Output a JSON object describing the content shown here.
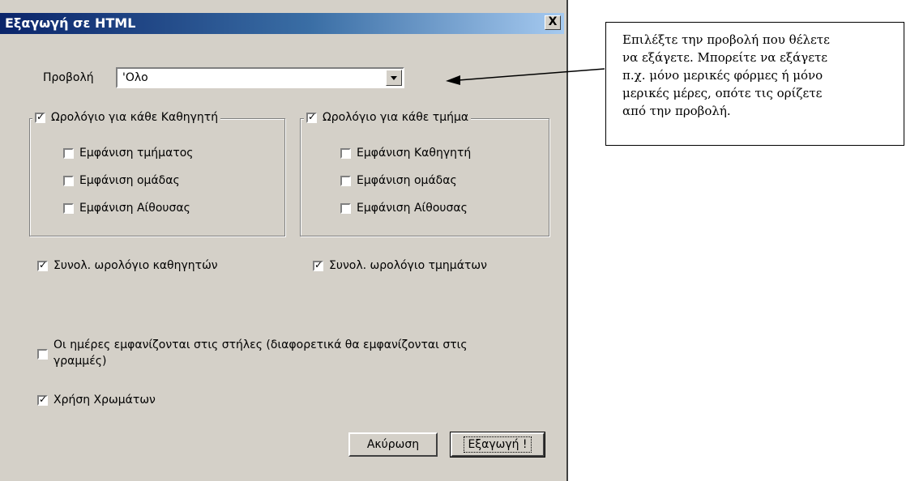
{
  "dialog": {
    "title": "Εξαγωγή σε HTML",
    "close_symbol": "X",
    "view_label": "Προβολή",
    "view_value": "'Ολο",
    "group_teacher": {
      "label": "Ωρολόγιο για κάθε Καθηγητή",
      "checked": true,
      "options": [
        {
          "label": "Εμφάνιση τμήματος",
          "checked": false
        },
        {
          "label": "Εμφάνιση ομάδας",
          "checked": false
        },
        {
          "label": "Εμφάνιση Αίθουσας",
          "checked": false
        }
      ]
    },
    "group_class": {
      "label": "Ωρολόγιο για κάθε τμήμα",
      "checked": true,
      "options": [
        {
          "label": "Εμφάνιση Καθηγητή",
          "checked": false
        },
        {
          "label": "Εμφάνιση ομάδας",
          "checked": false
        },
        {
          "label": "Εμφάνιση Αίθουσας",
          "checked": false
        }
      ]
    },
    "total_teachers": {
      "label": "Συνολ. ωρολόγιο καθηγητών",
      "checked": true
    },
    "total_classes": {
      "label": "Συνολ. ωρολόγιο τμημάτων",
      "checked": true
    },
    "days_in_columns": {
      "line1": "Οι ημέρες εμφανίζονται στις στήλες (διαφορετικά θα εμφανίζονται στις",
      "line2": "γραμμές)",
      "checked": false
    },
    "use_colors": {
      "label": "Χρήση Χρωμάτων",
      "checked": true
    },
    "cancel_label": "Ακύρωση",
    "export_label": "Εξαγωγή !"
  },
  "callout": {
    "lines": [
      "Επιλέξτε την προβολή που θέλετε",
      "να εξάγετε. Μπορείτε να εξάγετε",
      "π.χ. μόνο μερικές φόρμες ή μόνο",
      "μερικές μέρες, οπότε τις ορίζετε",
      "από την προβολή."
    ]
  },
  "colors": {
    "titlebar_start": "#0a246a",
    "titlebar_end": "#a6caf0",
    "face": "#d4d0c8"
  }
}
